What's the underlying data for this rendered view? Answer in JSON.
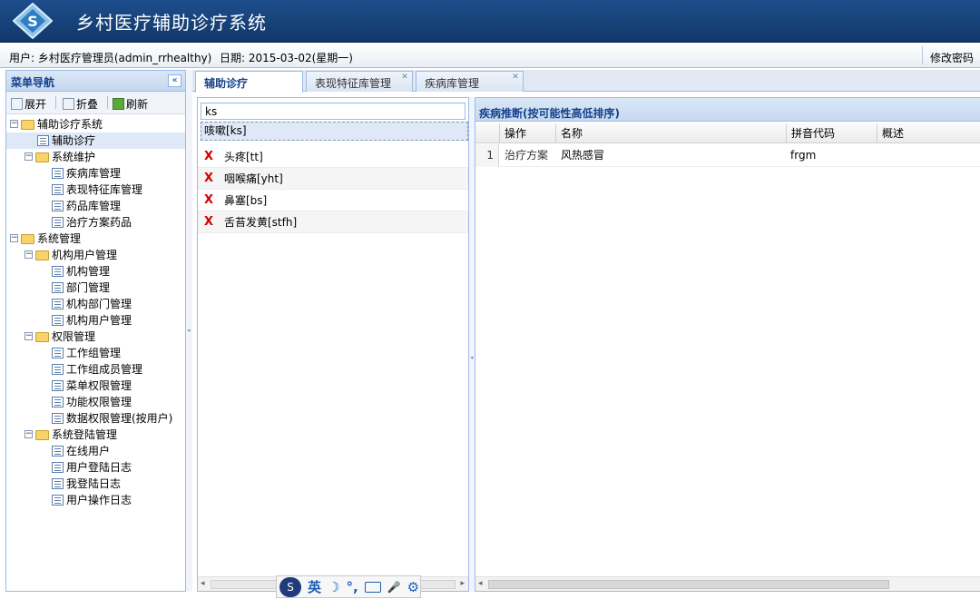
{
  "header": {
    "title": "乡村医疗辅助诊疗系统",
    "logo": "app-logo"
  },
  "infobar": {
    "user": "用户: 乡村医疗管理员(admin_rrhealthy)",
    "date": "日期: 2015-03-02(星期一)",
    "change_password": "修改密码"
  },
  "nav": {
    "title": "菜单导航",
    "collapse": "«",
    "tools": {
      "expand": "展开",
      "fold": "折叠",
      "refresh": "刷新"
    },
    "tree": [
      {
        "label": "辅助诊疗系统",
        "type": "folder",
        "level": 0,
        "expanded": true
      },
      {
        "label": "辅助诊疗",
        "type": "page",
        "level": 1,
        "selected": true
      },
      {
        "label": "系统维护",
        "type": "folder",
        "level": 1,
        "expanded": true
      },
      {
        "label": "疾病库管理",
        "type": "page",
        "level": 2
      },
      {
        "label": "表现特征库管理",
        "type": "page",
        "level": 2
      },
      {
        "label": "药品库管理",
        "type": "page",
        "level": 2
      },
      {
        "label": "治疗方案药品",
        "type": "page",
        "level": 2
      },
      {
        "label": "系统管理",
        "type": "folder",
        "level": 0,
        "expanded": true
      },
      {
        "label": "机构用户管理",
        "type": "folder",
        "level": 1,
        "expanded": true
      },
      {
        "label": "机构管理",
        "type": "page",
        "level": 2
      },
      {
        "label": "部门管理",
        "type": "page",
        "level": 2
      },
      {
        "label": "机构部门管理",
        "type": "page",
        "level": 2
      },
      {
        "label": "机构用户管理",
        "type": "page",
        "level": 2
      },
      {
        "label": "权限管理",
        "type": "folder",
        "level": 1,
        "expanded": true
      },
      {
        "label": "工作组管理",
        "type": "page",
        "level": 2
      },
      {
        "label": "工作组成员管理",
        "type": "page",
        "level": 2
      },
      {
        "label": "菜单权限管理",
        "type": "page",
        "level": 2
      },
      {
        "label": "功能权限管理",
        "type": "page",
        "level": 2
      },
      {
        "label": "数据权限管理(按用户)",
        "type": "page",
        "level": 2
      },
      {
        "label": "系统登陆管理",
        "type": "folder",
        "level": 1,
        "expanded": true
      },
      {
        "label": "在线用户",
        "type": "page",
        "level": 2
      },
      {
        "label": "用户登陆日志",
        "type": "page",
        "level": 2
      },
      {
        "label": "我登陆日志",
        "type": "page",
        "level": 2
      },
      {
        "label": "用户操作日志",
        "type": "page",
        "level": 2
      }
    ]
  },
  "tabs": [
    {
      "label": "辅助诊疗",
      "active": true,
      "closable": false
    },
    {
      "label": "表现特征库管理",
      "active": false,
      "closable": true
    },
    {
      "label": "疾病库管理",
      "active": false,
      "closable": true
    }
  ],
  "symptom_panel": {
    "search_value": "ks",
    "suggestion": "咳嗽[ks]",
    "remove_mark": "X",
    "items": [
      "头疼[tt]",
      "咽喉痛[yht]",
      "鼻塞[bs]",
      "舌苔发黄[stfh]"
    ]
  },
  "disease_panel": {
    "title": "疾病推断(按可能性高低排序)",
    "columns": [
      "操作",
      "名称",
      "拼音代码",
      "概述"
    ],
    "rows": [
      {
        "num": "1",
        "action": "治疗方案",
        "name": "风热感冒",
        "code": "frgm",
        "summary": ""
      }
    ]
  },
  "ime": {
    "mode": "英",
    "moon": "☽",
    "punct": "°,",
    "mic": "🎤",
    "gear": "⚙"
  }
}
